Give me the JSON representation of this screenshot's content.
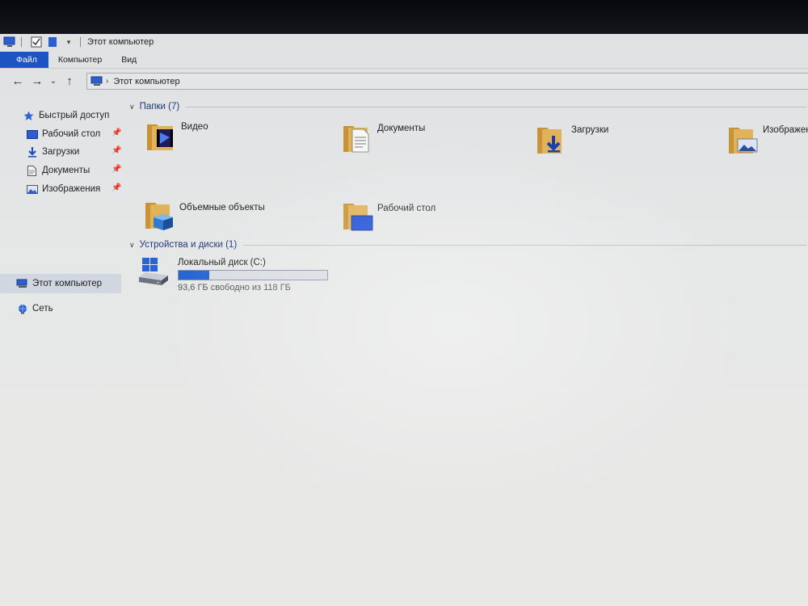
{
  "window": {
    "title": "Этот компьютер"
  },
  "ribbon": {
    "tabs": [
      {
        "label": "Файл"
      },
      {
        "label": "Компьютер"
      },
      {
        "label": "Вид"
      }
    ]
  },
  "address": {
    "path": "Этот компьютер"
  },
  "navpane": {
    "quick_access": "Быстрый доступ",
    "pinned": [
      {
        "label": "Рабочий стол",
        "icon": "desktop-icon"
      },
      {
        "label": "Загрузки",
        "icon": "downloads-icon"
      },
      {
        "label": "Документы",
        "icon": "documents-icon"
      },
      {
        "label": "Изображения",
        "icon": "pictures-icon"
      }
    ],
    "this_pc": "Этот компьютер",
    "network": "Сеть"
  },
  "content": {
    "folders_header": "Папки (7)",
    "folders": [
      {
        "label": "Видео",
        "icon": "video-folder-icon"
      },
      {
        "label": "Документы",
        "icon": "documents-folder-icon"
      },
      {
        "label": "Загрузки",
        "icon": "downloads-folder-icon"
      },
      {
        "label": "Изображен",
        "icon": "pictures-folder-icon"
      },
      {
        "label": "Объемные объекты",
        "icon": "3d-objects-folder-icon"
      },
      {
        "label": "Рабочий стол",
        "icon": "desktop-folder-icon"
      }
    ],
    "devices_header": "Устройства и диски (1)",
    "drive": {
      "name": "Локальный диск (C:)",
      "free_text": "93,6 ГБ свободно из 118 ГБ",
      "used_fraction": 0.207
    }
  },
  "colors": {
    "accent": "#1d54c4",
    "usage_bar": "#2563d2",
    "folder": "#d8a84a"
  }
}
